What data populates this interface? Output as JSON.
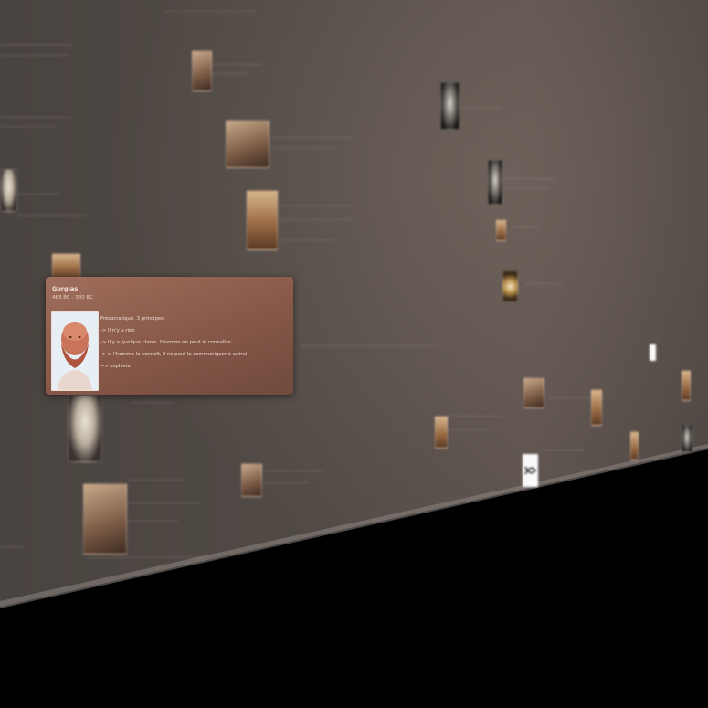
{
  "popup": {
    "title": "Gorgias",
    "dates": "483 BC - 380 BC",
    "description_lines": [
      "Présocratique. 3 principes",
      "-> Il n'y a rien",
      "-> Il y a quelque chose, l'homme ne peut le connaître",
      "-> si l'homme le connaît, il ne peut le communiquer à autrui",
      "=> sophiste"
    ]
  },
  "colors": {
    "wall": "#514a45",
    "popup_bg": "#875848",
    "popup_text": "#f0ddd4",
    "floor": "#000000"
  },
  "icons": {
    "fish_symbol": "ichthys-icon"
  }
}
